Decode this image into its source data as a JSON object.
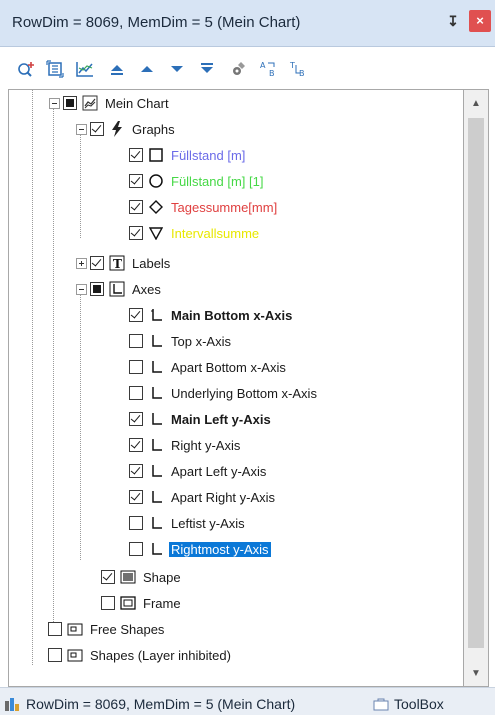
{
  "window": {
    "title": "RowDim = 8069, MemDim = 5 (Mein Chart)",
    "pin_glyph": "↧",
    "close_glyph": "×"
  },
  "toolbar": [
    "zoom-add-icon",
    "fit-icon",
    "chart-icon",
    "move-top-icon",
    "move-up-icon",
    "move-down-icon",
    "move-bottom-icon",
    "properties-icon",
    "swap-ab-icon",
    "swap-tb-icon"
  ],
  "tree": {
    "root": "Mein Chart",
    "graphs": "Graphs",
    "graph_items": [
      {
        "label": "Füllstand [m]",
        "color": "#6b6be8"
      },
      {
        "label": "Füllstand [m] [1]",
        "color": "#46d846"
      },
      {
        "label": "Tagessumme[mm]",
        "color": "#e04040"
      },
      {
        "label": "Intervallsumme",
        "color": "#e8e800"
      }
    ],
    "labels": "Labels",
    "axes": "Axes",
    "axis_items": [
      {
        "label": "Main Bottom x-Axis",
        "checked": true,
        "bold": true
      },
      {
        "label": "Top x-Axis",
        "checked": false,
        "bold": false
      },
      {
        "label": "Apart Bottom x-Axis",
        "checked": false,
        "bold": false
      },
      {
        "label": "Underlying Bottom x-Axis",
        "checked": false,
        "bold": false
      },
      {
        "label": "Main Left y-Axis",
        "checked": true,
        "bold": true
      },
      {
        "label": "Right y-Axis",
        "checked": true,
        "bold": false
      },
      {
        "label": "Apart Left y-Axis",
        "checked": true,
        "bold": false
      },
      {
        "label": "Apart Right y-Axis",
        "checked": true,
        "bold": false
      },
      {
        "label": "Leftist y-Axis",
        "checked": false,
        "bold": false
      },
      {
        "label": "Rightmost y-Axis",
        "checked": false,
        "bold": false,
        "selected": true
      }
    ],
    "shape": "Shape",
    "frame": "Frame",
    "free_shapes": "Free Shapes",
    "shapes_inhibited": "Shapes (Layer inhibited)"
  },
  "bottom_tabs": [
    "RowDim = 8069, MemDim = 5 (Mein Chart)",
    "ToolBox"
  ]
}
